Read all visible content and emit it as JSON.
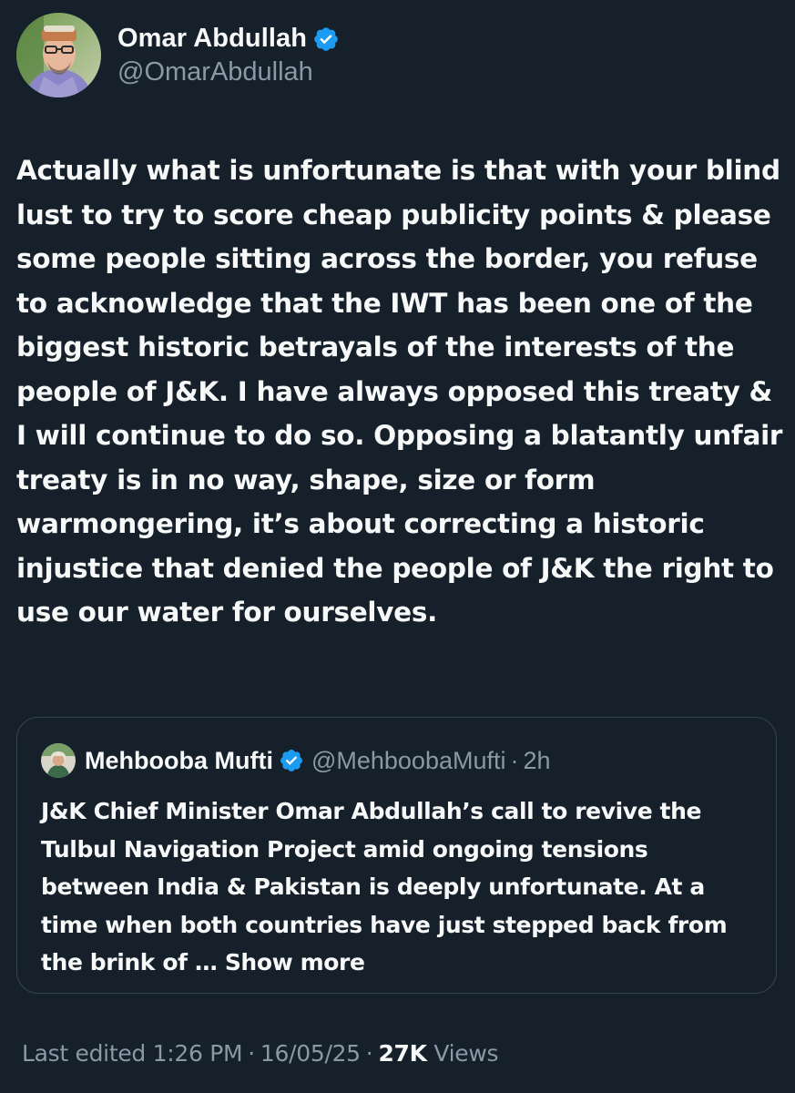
{
  "author": {
    "display_name": "Omar Abdullah",
    "handle": "@OmarAbdullah",
    "verified": true,
    "avatar": "profile-photo"
  },
  "tweet": {
    "text": "Actually what is unfortunate is that with your blind lust to try to score cheap publicity points & please some people sitting across the border, you refuse to acknowledge that the IWT has been one of the biggest historic betrayals of the interests of the people of J&K. I have always opposed this treaty & I will continue to do so. Opposing a blatantly unfair treaty is in no way, shape, size or form warmongering, it’s about correcting a historic injustice that denied the people of J&K the right to use our water for ourselves."
  },
  "quoted_tweet": {
    "display_name": "Mehbooba Mufti",
    "handle": "@MehboobaMufti",
    "separator": "·",
    "time": "2h",
    "verified": true,
    "text": "J&K Chief Minister Omar Abdullah’s call to revive the Tulbul Navigation Project amid ongoing tensions between India & Pakistan is deeply unfortunate. At a time when both countries have just stepped back from the brink of …",
    "show_more_label": "Show more"
  },
  "meta": {
    "edited_label": "Last edited 1:26 PM",
    "separator": "·",
    "date": "16/05/25",
    "views_count": "27K",
    "views_label": "Views"
  },
  "colors": {
    "background": "#15202b",
    "text_primary": "#f7f9f9",
    "text_secondary": "#8b98a5",
    "verified_badge": "#1d9bf0",
    "border": "#38444d"
  }
}
